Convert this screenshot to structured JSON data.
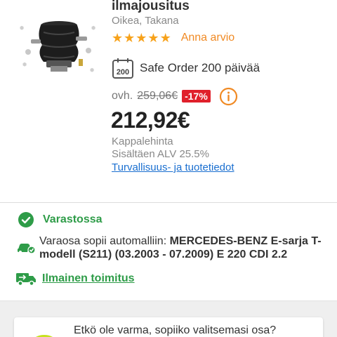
{
  "product": {
    "title": "ilmajousitus",
    "position": "Oikea, Takana",
    "rating_stars": 5,
    "review_link": "Anna arvio",
    "image_icon": "air-suspension-part-image"
  },
  "safe_order": {
    "icon_text": "200",
    "label": "Safe Order 200 päivää"
  },
  "pricing": {
    "old_prefix": "ovh.",
    "old_price": "259,06€",
    "discount": "-17%",
    "price": "212,92€",
    "unit_label": "Kappalehinta",
    "vat_label": "Sisältäen ALV 25.5%",
    "safety_link": "Turvallisuus- ja tuotetiedot"
  },
  "availability": {
    "stock_label": "Varastossa",
    "fits_prefix": "Varaosa sopii automalliin: ",
    "fits_model": "MERCEDES-BENZ E-sarja T-modell (S211) (03.2003 - 07.2009) E 220 CDI 2.2",
    "delivery_label": "Ilmainen toimitus"
  },
  "help": {
    "text": "Etkö ole varma, sopiiko valitsemasi osa?"
  },
  "colors": {
    "accent_orange": "#f08a24",
    "star": "#f7a21b",
    "discount_red": "#e0202b",
    "success_green": "#2e9c48",
    "link_blue": "#1a6fd0"
  }
}
